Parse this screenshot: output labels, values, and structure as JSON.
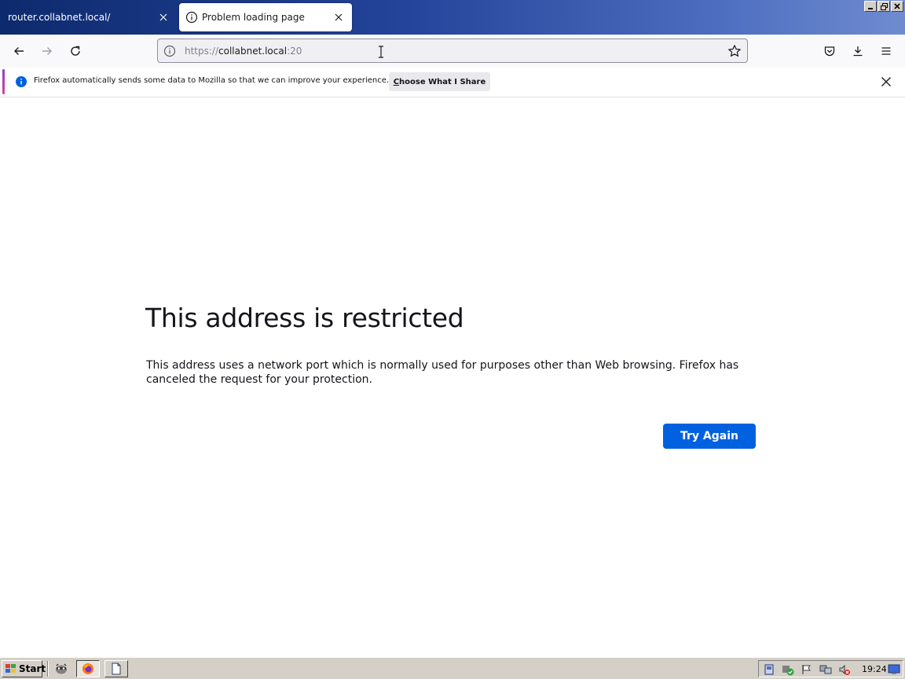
{
  "tabs": [
    {
      "label": "router.collabnet.local/",
      "active": false
    },
    {
      "label": "Problem loading page",
      "active": true
    }
  ],
  "window_controls": {
    "minimize_icon": "minimize-icon",
    "restore_icon": "restore-icon",
    "close_icon": "close-icon"
  },
  "urlbar": {
    "scheme": "https://",
    "host": "collabnet.local",
    "port": ":20"
  },
  "notification": {
    "message": "Firefox automatically sends some data to Mozilla so that we can improve your experience.",
    "button_label_first": "C",
    "button_label_rest": "hoose What I Share"
  },
  "error_page": {
    "title": "This address is restricted",
    "description": "This address uses a network port which is normally used for purposes other than Web browsing. Firefox has canceled the request for your protection.",
    "try_again_label": "Try Again"
  },
  "taskbar": {
    "start_label": "Start",
    "clock": "19:24"
  },
  "colors": {
    "accent_button": "#0061e0",
    "title_bar_gradient_start": "#0e2a6e",
    "taskbar_bg": "#d4d0c8"
  }
}
